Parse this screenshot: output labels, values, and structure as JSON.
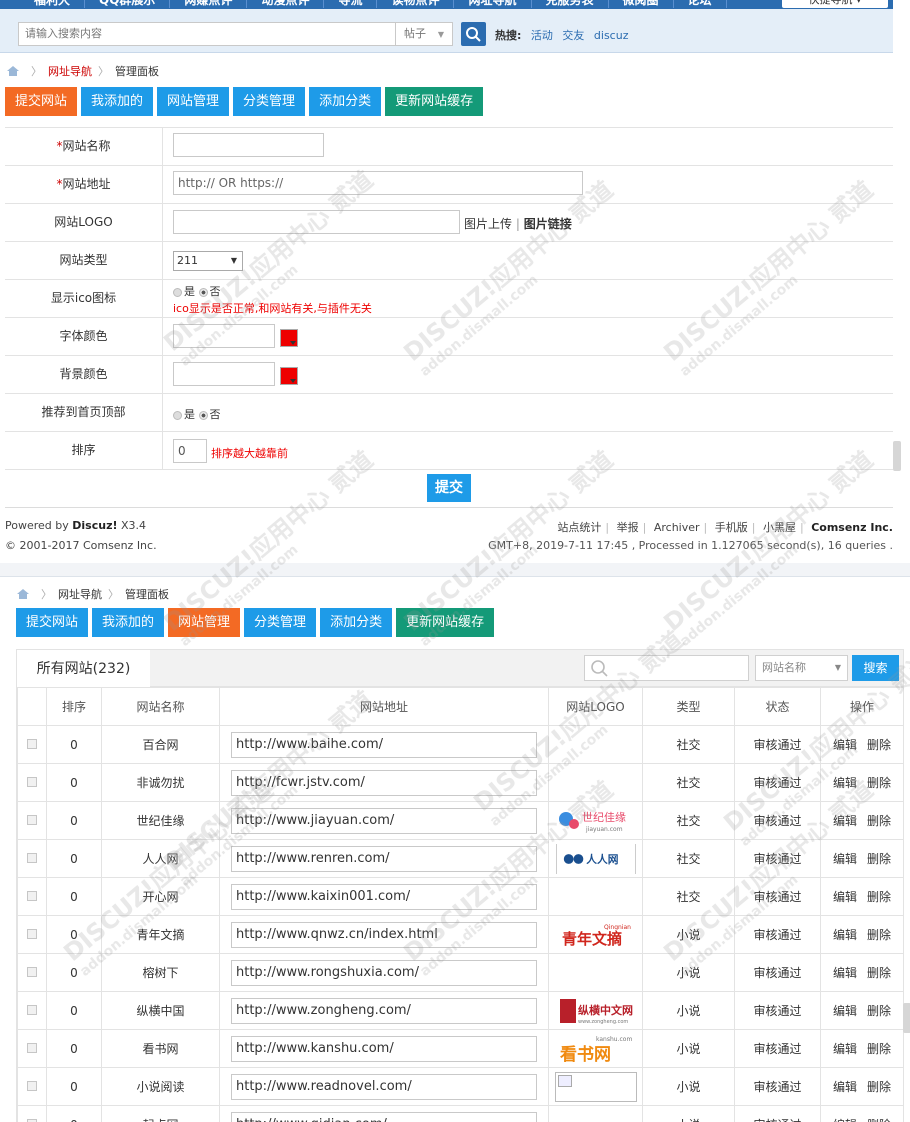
{
  "topnav": {
    "items": [
      "福利大",
      "QQ群展示",
      "网赚点评",
      "动漫点评",
      "导流",
      "读物点评",
      "网址导航",
      "兑服务表",
      "微阅圈",
      "论坛"
    ],
    "fast_nav": "快捷导航 ▾"
  },
  "search": {
    "placeholder": "请输入搜索内容",
    "type": "帖子",
    "hot_label": "热搜:",
    "hot_links": [
      "活动",
      "交友",
      "discuz"
    ]
  },
  "breadcrumb1": {
    "nav": "网址导航",
    "current": "管理面板"
  },
  "tabs1": [
    {
      "label": "提交网站",
      "state": "active"
    },
    {
      "label": "我添加的",
      "state": "normal"
    },
    {
      "label": "网站管理",
      "state": "normal"
    },
    {
      "label": "分类管理",
      "state": "normal"
    },
    {
      "label": "添加分类",
      "state": "normal"
    },
    {
      "label": "更新网站缓存",
      "state": "green"
    }
  ],
  "form": {
    "name_label": "网站名称",
    "url_label": "网站地址",
    "url_placeholder": "http:// OR https://",
    "logo_label": "网站LOGO",
    "logo_upload": "图片上传",
    "logo_link": "图片链接",
    "type_label": "网站类型",
    "type_value": "211",
    "ico_label": "显示ico图标",
    "yes": "是",
    "no": "否",
    "ico_note": "ico显示是否正常,和网站有关,与插件无关",
    "font_color_label": "字体颜色",
    "bg_color_label": "背景颜色",
    "recommend_label": "推荐到首页顶部",
    "sort_label": "排序",
    "sort_value": "0",
    "sort_note": "排序越大越靠前",
    "submit": "提交",
    "accent_red": "#ee0000"
  },
  "footer": {
    "powered_prefix": "Powered by ",
    "powered_brand": "Discuz!",
    "powered_version": " X3.4",
    "copyright": "© 2001-2017 Comsenz Inc.",
    "links": [
      "站点统计",
      "举报",
      "Archiver",
      "手机版",
      "小黑屋"
    ],
    "company": "Comsenz Inc.",
    "stats": "GMT+8, 2019-7-11 17:45 , Processed in 1.127065 second(s), 16 queries ."
  },
  "breadcrumb2": {
    "nav": "网址导航",
    "current": "管理面板"
  },
  "tabs2": [
    {
      "label": "提交网站",
      "state": "normal"
    },
    {
      "label": "我添加的",
      "state": "normal"
    },
    {
      "label": "网站管理",
      "state": "active"
    },
    {
      "label": "分类管理",
      "state": "normal"
    },
    {
      "label": "添加分类",
      "state": "normal"
    },
    {
      "label": "更新网站缓存",
      "state": "green"
    }
  ],
  "list": {
    "all_sites": "所有网站(232)",
    "filter_field": "网站名称",
    "search_btn": "搜索",
    "columns": [
      "",
      "排序",
      "网站名称",
      "网站地址",
      "网站LOGO",
      "类型",
      "状态",
      "操作"
    ],
    "edit": "编辑",
    "delete": "删除",
    "rows": [
      {
        "sort": "0",
        "name": "百合网",
        "url": "http://www.baihe.com/",
        "logo": "",
        "type": "社交",
        "status": "审核通过"
      },
      {
        "sort": "0",
        "name": "非诚勿扰",
        "url": "http://fcwr.jstv.com/",
        "logo": "",
        "type": "社交",
        "status": "审核通过",
        "red": true
      },
      {
        "sort": "0",
        "name": "世纪佳缘",
        "url": "http://www.jiayuan.com/",
        "logo": "jiayuan",
        "type": "社交",
        "status": "审核通过"
      },
      {
        "sort": "0",
        "name": "人人网",
        "url": "http://www.renren.com/",
        "logo": "renren",
        "type": "社交",
        "status": "审核通过"
      },
      {
        "sort": "0",
        "name": "开心网",
        "url": "http://www.kaixin001.com/",
        "logo": "",
        "type": "社交",
        "status": "审核通过"
      },
      {
        "sort": "0",
        "name": "青年文摘",
        "url": "http://www.qnwz.cn/index.html",
        "logo": "qnwz",
        "type": "小说",
        "status": "审核通过"
      },
      {
        "sort": "0",
        "name": "榕树下",
        "url": "http://www.rongshuxia.com/",
        "logo": "",
        "type": "小说",
        "status": "审核通过"
      },
      {
        "sort": "0",
        "name": "纵横中国",
        "url": "http://www.zongheng.com/",
        "logo": "zongheng",
        "type": "小说",
        "status": "审核通过"
      },
      {
        "sort": "0",
        "name": "看书网",
        "url": "http://www.kanshu.com/",
        "logo": "kanshu",
        "type": "小说",
        "status": "审核通过"
      },
      {
        "sort": "0",
        "name": "小说阅读",
        "url": "http://www.readnovel.com/",
        "logo": "broken",
        "type": "小说",
        "status": "审核通过"
      },
      {
        "sort": "0",
        "name": "起点网",
        "url": "http://www.qidian.com/",
        "logo": "",
        "type": "小说",
        "status": "审核通过"
      }
    ]
  },
  "logo_text": {
    "jiayuan": "世纪佳缘",
    "jiayuan_sub": "jiayuan.com",
    "renren": "人人网",
    "qnwz": "青年文摘",
    "qnwz_sub": "Qingnian",
    "zongheng": "纵横中文网",
    "zongheng_sub": "www.zongheng.com",
    "kanshu": "看书网",
    "kanshu_sub": "kanshu.com"
  },
  "watermark": {
    "line1": "DISCUZ!应用中心 贰道",
    "line2": "addon.dismall.com"
  },
  "colors": {
    "blue": "#1e9be8",
    "orange": "#f36a24",
    "green": "#149a78",
    "nav": "#2b6cb0",
    "red": "#cc0000"
  }
}
